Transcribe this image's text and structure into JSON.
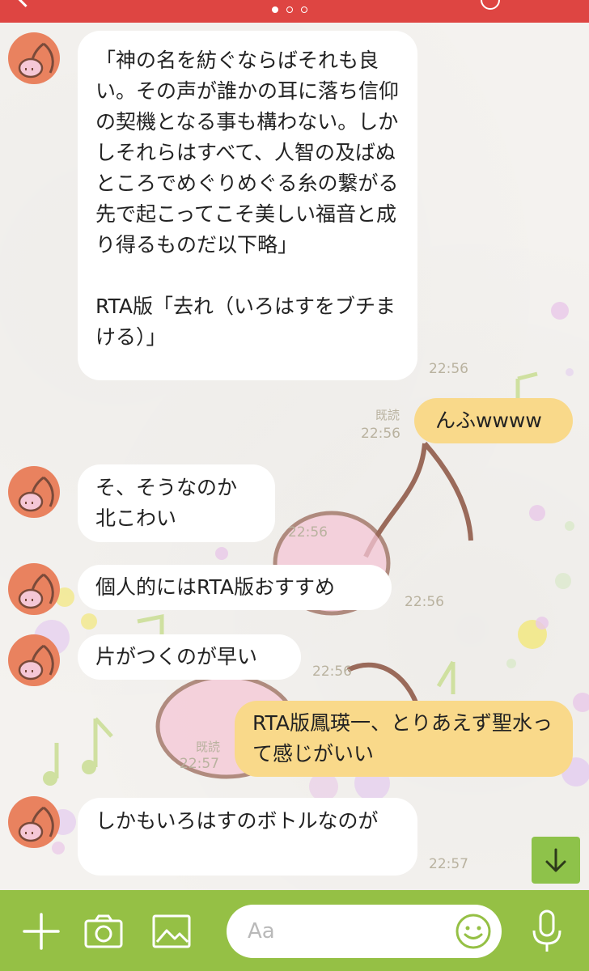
{
  "header": {
    "page_dots": 3,
    "active_page": 1
  },
  "messages": [
    {
      "direction": "incoming",
      "text": "「神の名を紡ぐならばそれも良い。その声が誰かの耳に落ち信仰の契機となる事も構わない。しかしそれらはすべて、人智の及ばぬところでめぐりめぐる糸の繋がる先で起こってこそ美しい福音と成り得るものだ以下略」\n\nRTA版「去れ（いろはすをブチまける）」",
      "time": "22:56"
    },
    {
      "direction": "outgoing",
      "text": "んふwwww",
      "time": "22:56",
      "read": "既読"
    },
    {
      "direction": "incoming",
      "text": "そ、そうなのか\n北こわい",
      "time": "22:56"
    },
    {
      "direction": "incoming",
      "text": "個人的にはRTA版おすすめ",
      "time": "22:56"
    },
    {
      "direction": "incoming",
      "text": "片がつくのが早い",
      "time": "22:56"
    },
    {
      "direction": "outgoing",
      "text": "RTA版鳳瑛一、とりあえず聖水って感じがいい",
      "time": "22:57",
      "read": "既読"
    },
    {
      "direction": "incoming",
      "text": "しかもいろはすのボトルなのが",
      "time": "22:57"
    }
  ],
  "composer": {
    "placeholder": "Aa",
    "icons": [
      "plus-icon",
      "camera-icon",
      "image-icon",
      "emoji-icon",
      "microphone-icon"
    ]
  },
  "colors": {
    "header": "#de4542",
    "bottom_bar": "#95c045",
    "outgoing_bubble": "#f9d98a",
    "incoming_bubble": "#ffffff",
    "avatar": "#e9825f"
  }
}
